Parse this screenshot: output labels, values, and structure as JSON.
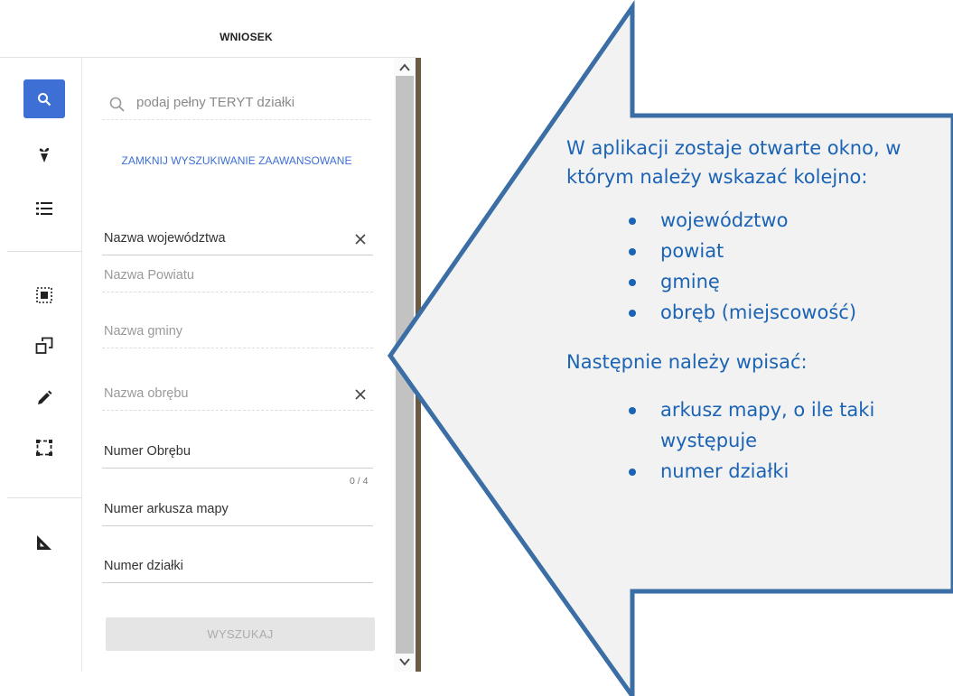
{
  "header": {
    "title": "WNIOSEK"
  },
  "toolbar": {
    "tools": [
      {
        "name": "search-tool",
        "icon": "search-icon",
        "active": true
      },
      {
        "name": "crop-tool",
        "icon": "plant-icon",
        "active": false
      },
      {
        "name": "list-tool",
        "icon": "list-icon",
        "active": false
      },
      {
        "name": "select-area-tool",
        "icon": "select-area-icon",
        "active": false
      },
      {
        "name": "copy-tool",
        "icon": "copy-icon",
        "active": false
      },
      {
        "name": "draw-tool",
        "icon": "pencil-icon",
        "active": false
      },
      {
        "name": "frame-tool",
        "icon": "frame-icon",
        "active": false
      },
      {
        "name": "measure-tool",
        "icon": "ruler-triangle-icon",
        "active": false
      }
    ],
    "accent_color": "#3d6fd4"
  },
  "search": {
    "placeholder": "podaj pełny TERYT działki",
    "advanced_close_label": "ZAMKNIJ WYSZUKIWANIE ZAAWANSOWANE"
  },
  "fields": {
    "wojewodztwo": {
      "label": "Nazwa województwa",
      "clearable": true
    },
    "powiat": {
      "label": "Nazwa Powiatu"
    },
    "gmina": {
      "label": "Nazwa gminy"
    },
    "obreb": {
      "label": "Nazwa obrębu",
      "clearable": true
    },
    "numer_obrebu": {
      "label": "Numer Obrębu",
      "counter": "0 / 4"
    },
    "arkusz": {
      "label": "Numer arkusza mapy"
    },
    "dzialka": {
      "label": "Numer działki"
    }
  },
  "buttons": {
    "search_label": "WYSZUKAJ"
  },
  "callout": {
    "intro": "W aplikacji zostaje otwarte okno, w którym należy wskazać kolejno:",
    "items1": [
      "województwo",
      "powiat",
      "gminę",
      "obręb (miejscowość)"
    ],
    "next": "Następnie należy wpisać:",
    "items2": [
      "arkusz mapy, o ile taki występuje",
      "numer działki"
    ],
    "text_color": "#1b63b4",
    "fill_color": "#f2f2f2",
    "border_color": "#3a6ea5"
  }
}
